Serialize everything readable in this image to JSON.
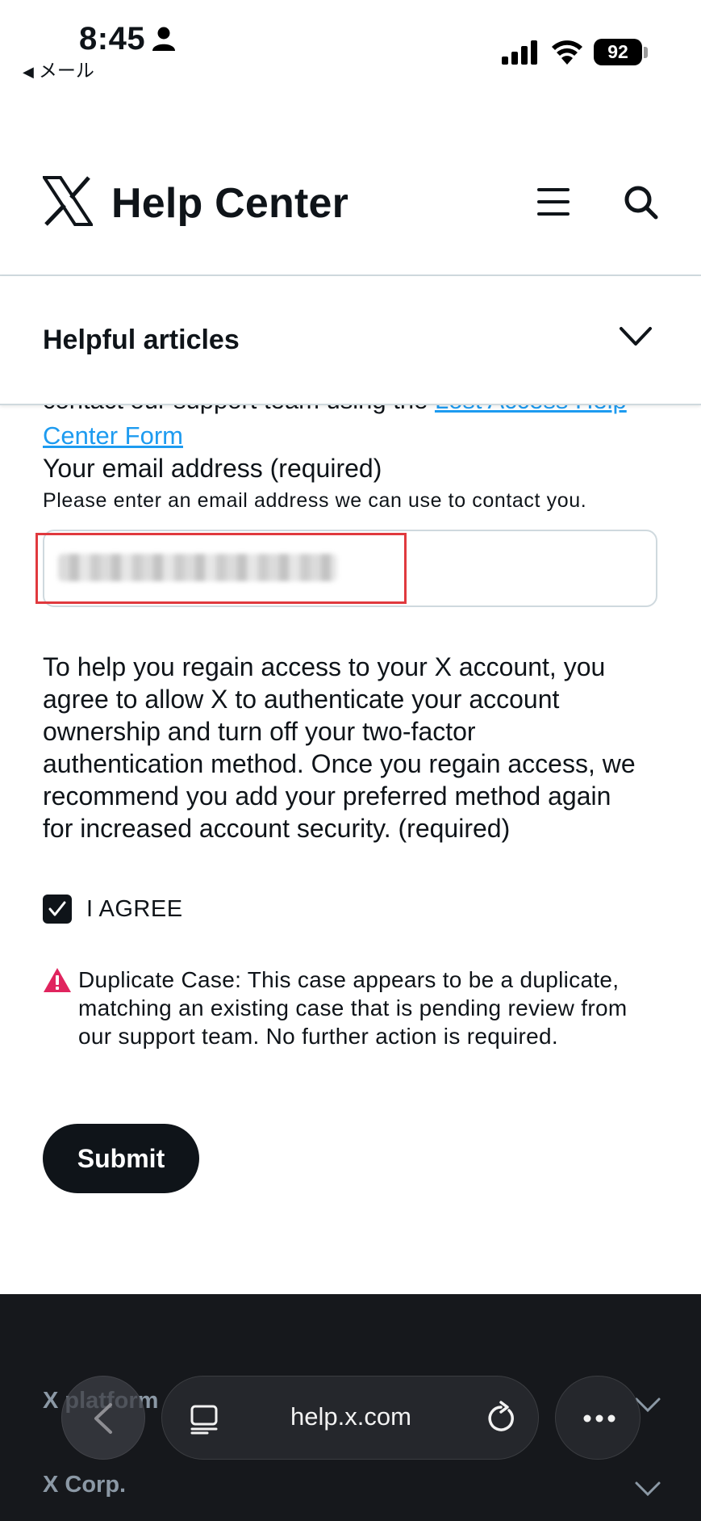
{
  "status_bar": {
    "time": "8:45",
    "back_app": "メール",
    "battery": "92"
  },
  "header": {
    "title": "Help Center"
  },
  "articles": {
    "title": "Helpful articles"
  },
  "form": {
    "cut_text": "contact our support team using the ",
    "cut_link": "Lost Access Help",
    "link_continued": "Center Form",
    "email_label": "Your email address",
    "required_suffix": "(required)",
    "email_hint": "Please enter an email address we can use to contact you.",
    "email_value_blurred": true,
    "consent_text": "To help you regain access to your X account, you agree to allow X to authenticate your account ownership and turn off your two-factor authentication method. Once you regain access, we recommend you add your preferred method again for increased account security.",
    "consent_required": "(required)",
    "agree_label": "I AGREE",
    "agree_checked": true,
    "warning_text": "Duplicate Case: This case appears to be a duplicate, matching an existing case that is pending review from our support team. No further action is required.",
    "submit_label": "Submit"
  },
  "footer": {
    "items": [
      "X platform",
      "X Corp."
    ]
  },
  "browser": {
    "url": "help.x.com"
  },
  "colors": {
    "link": "#1d9bf0",
    "text": "#0f1419",
    "highlight": "#e0393e",
    "warning": "#e0245e",
    "footer_bg": "#16181c"
  }
}
